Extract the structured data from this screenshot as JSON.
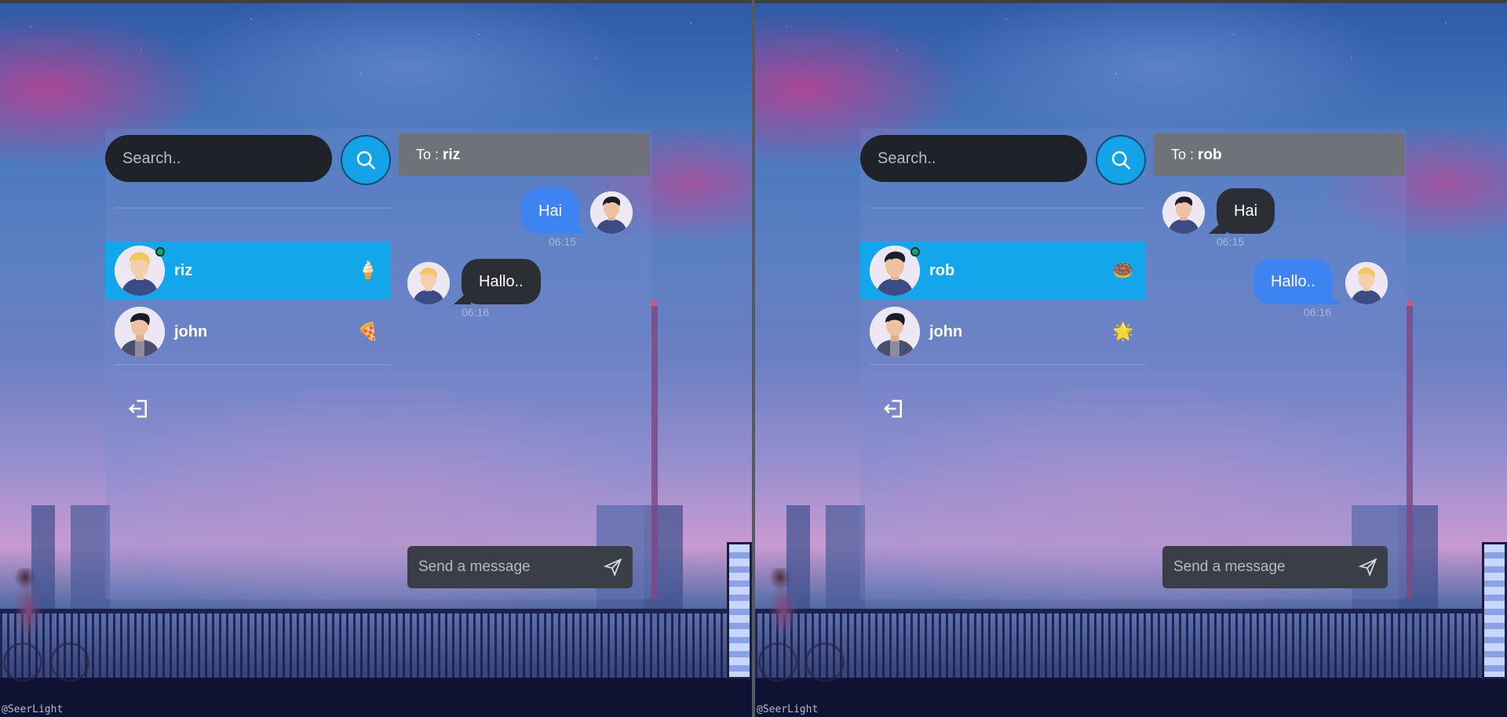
{
  "watermark": "@SeerLight",
  "windows": [
    {
      "search_placeholder": "Search..",
      "contacts": [
        {
          "name": "riz",
          "emoji": "🍦",
          "online": true,
          "active": true
        },
        {
          "name": "john",
          "emoji": "🍕",
          "online": false,
          "active": false
        }
      ],
      "to_prefix": "To :",
      "to_name": "riz",
      "messages": [
        {
          "text": "Hai",
          "time": "06:15",
          "side": "right",
          "color": "blue"
        },
        {
          "text": "Hallo..",
          "time": "06:16",
          "side": "left",
          "color": "dark"
        }
      ],
      "message_placeholder": "Send a message"
    },
    {
      "search_placeholder": "Search..",
      "contacts": [
        {
          "name": "rob",
          "emoji": "🍩",
          "online": true,
          "active": true
        },
        {
          "name": "john",
          "emoji": "🌟",
          "online": false,
          "active": false
        }
      ],
      "to_prefix": "To :",
      "to_name": "rob",
      "messages": [
        {
          "text": "Hai",
          "time": "06:15",
          "side": "left",
          "color": "dark"
        },
        {
          "text": "Hallo..",
          "time": "06:16",
          "side": "right",
          "color": "blue"
        }
      ],
      "message_placeholder": "Send a message"
    }
  ],
  "colors": {
    "accent": "#14a6ea",
    "bubble_blue": "#3d84f2",
    "bubble_dark": "#2b2f35",
    "input_bg": "#1f2329",
    "online": "#1aa46a"
  },
  "icons": {
    "search": "search-icon",
    "logout": "logout-icon",
    "send": "send-icon"
  }
}
